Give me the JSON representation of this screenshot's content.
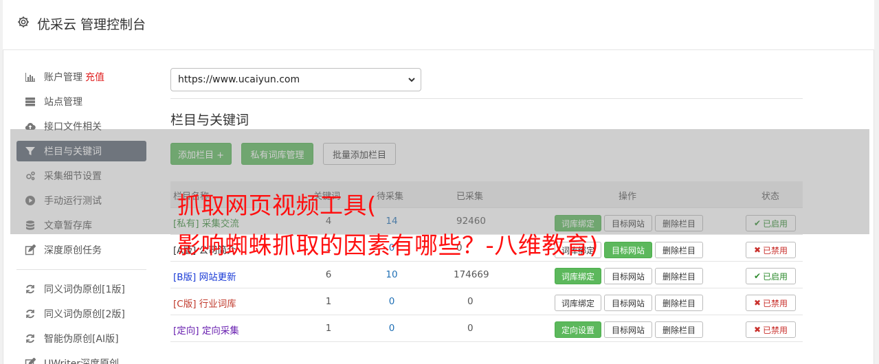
{
  "header": {
    "title": "优采云 管理控制台"
  },
  "sidebar": {
    "items": [
      {
        "label": "账户管理",
        "extra": "充值",
        "icon": "bar-chart-icon"
      },
      {
        "label": "站点管理",
        "icon": "server-icon"
      },
      {
        "label": "接口文件相关",
        "icon": "cloud-upload-icon"
      },
      {
        "label": "栏目与关键词",
        "icon": "filter-icon"
      },
      {
        "label": "采集细节设置",
        "icon": "gears-icon"
      },
      {
        "label": "手动运行测试",
        "icon": "play-circle-icon"
      },
      {
        "label": "文章暂存库",
        "icon": "database-icon"
      },
      {
        "label": "深度原创任务",
        "icon": "edit-icon"
      },
      {
        "label": "同义词伪原创[1版]",
        "icon": "refresh-icon"
      },
      {
        "label": "同义词伪原创[2版]",
        "icon": "refresh-icon"
      },
      {
        "label": "智能伪原创[AI版]",
        "icon": "refresh-icon"
      },
      {
        "label": "UWriter深度原创",
        "icon": "edit-icon"
      }
    ]
  },
  "site_select": {
    "value": "https://www.ucaiyun.com"
  },
  "section": {
    "title": "栏目与关键词"
  },
  "toolbar": {
    "add": "添加栏目 +",
    "private_lib": "私有词库管理",
    "batch_add": "批量添加栏目"
  },
  "table": {
    "headers": {
      "name": "栏目名称",
      "keywords": "关键词",
      "pending": "待采集",
      "collected": "已采集",
      "ops": "操作",
      "status": "状态"
    },
    "rows": [
      {
        "name": "[私有] 采集交流",
        "kw": "4",
        "pending": "14",
        "collected": "92460",
        "op1": "词库绑定",
        "op2": "目标网站",
        "op3": "删除栏目",
        "status": "已启用"
      },
      {
        "name": "[A版] 公司简介",
        "kw": "1",
        "pending": "0",
        "collected": "0",
        "op1": "词库绑定",
        "op2": "目标网站",
        "op3": "删除栏目",
        "status": "已禁用"
      },
      {
        "name": "[B版] 网站更新",
        "kw": "6",
        "pending": "10",
        "collected": "174669",
        "op1": "词库绑定",
        "op2": "目标网站",
        "op3": "删除栏目",
        "status": "已启用"
      },
      {
        "name": "[C版] 行业词库",
        "kw": "1",
        "pending": "0",
        "collected": "0",
        "op1": "词库绑定",
        "op2": "目标网站",
        "op3": "删除栏目",
        "status": "已禁用"
      },
      {
        "name": "[定向] 定向采集",
        "kw": "1",
        "pending": "0",
        "collected": "0",
        "op1": "定向设置",
        "op2": "目标网站",
        "op3": "删除栏目",
        "status": "已禁用"
      }
    ]
  },
  "overlay": {
    "line1": "抓取网页视频工具(",
    "line2": "影响蜘蛛抓取的因素有哪些？-八维教育)"
  }
}
